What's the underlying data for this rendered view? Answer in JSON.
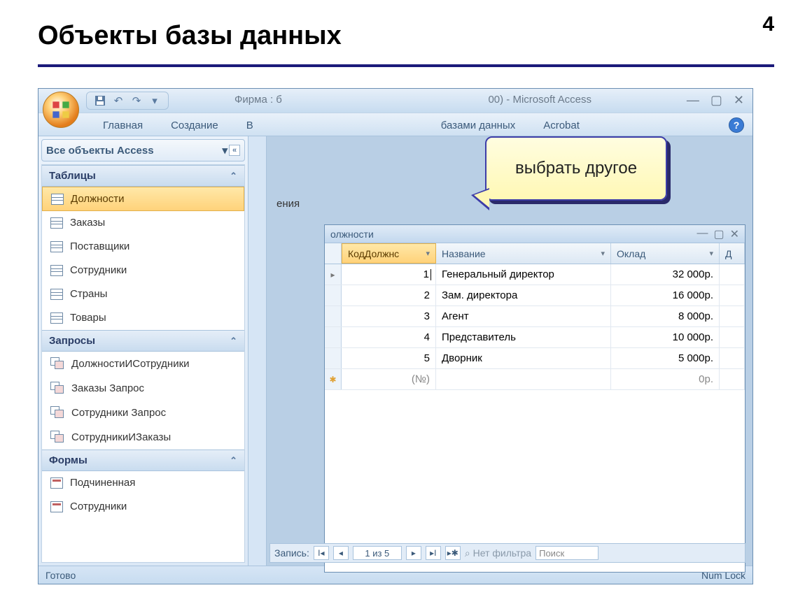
{
  "slide": {
    "title": "Объекты базы данных",
    "number": "4"
  },
  "callout": {
    "text": "выбрать другое"
  },
  "window": {
    "title_left": "Фирма : б",
    "title_right": "00) - Microsoft Access",
    "ribbon": {
      "tabs": [
        "Главная",
        "Создание",
        "В",
        "базами данных",
        "Acrobat"
      ],
      "help": "?"
    },
    "nav": {
      "header": "Все объекты Access",
      "groups": [
        {
          "title": "Таблицы",
          "type": "table",
          "items": [
            "Должности",
            "Заказы",
            "Поставщики",
            "Сотрудники",
            "Страны",
            "Товары"
          ],
          "selected": 0
        },
        {
          "title": "Запросы",
          "type": "query",
          "items": [
            "ДолжностиИСотрудники",
            "Заказы Запрос",
            "Сотрудники Запрос",
            "СотрудникиИЗаказы"
          ]
        },
        {
          "title": "Формы",
          "type": "form",
          "items": [
            "Подчиненная",
            "Сотрудники"
          ]
        }
      ]
    },
    "behind_fragment": "ения",
    "mdi": {
      "title": "олжности",
      "columns": {
        "id": "КодДолжнс",
        "name": "Название",
        "salary": "Оклад",
        "extra": "Д"
      },
      "rows": [
        {
          "id": "1",
          "name": "Генеральный директор",
          "salary": "32 000р."
        },
        {
          "id": "2",
          "name": "Зам. директора",
          "salary": "16 000р."
        },
        {
          "id": "3",
          "name": "Агент",
          "salary": "8 000р."
        },
        {
          "id": "4",
          "name": "Представитель",
          "salary": "10 000р."
        },
        {
          "id": "5",
          "name": "Дворник",
          "salary": "5 000р."
        }
      ],
      "newrow": {
        "id": "(№)",
        "salary": "0р."
      }
    },
    "recnav": {
      "label": "Запись:",
      "pos": "1 из 5",
      "filter": "Нет фильтра",
      "search": "Поиск"
    },
    "status": {
      "left": "Готово",
      "right": "Num Lock"
    }
  }
}
